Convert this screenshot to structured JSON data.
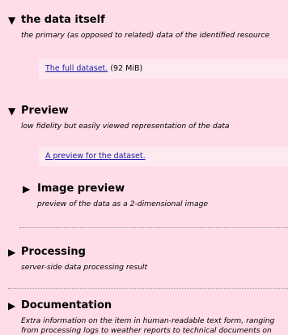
{
  "data_itself": {
    "title": "the data itself",
    "description": "the primary (as opposed to related) data of the identified resource",
    "link_text": "The full dataset.",
    "link_size": "(92 MiB)"
  },
  "preview": {
    "title": "Preview",
    "description": "low fidelity but easily viewed representation of the data",
    "link_text": "A preview for the dataset."
  },
  "image_preview": {
    "title": "Image preview",
    "description": "preview of the data as a 2-dimensional image"
  },
  "processing": {
    "title": "Processing",
    "description": "server-side data processing result"
  },
  "documentation": {
    "title": "Documentation",
    "description": "Extra information on the item in human-readable text form, ranging from processing logs to weather reports to technical documents on instruments to related publications."
  },
  "icons": {
    "expanded": "triangle-down-icon",
    "collapsed": "triangle-right-icon"
  },
  "colors": {
    "background": "#ffdde8",
    "link_box": "#ffe9f1",
    "link": "#1a1aa6"
  }
}
